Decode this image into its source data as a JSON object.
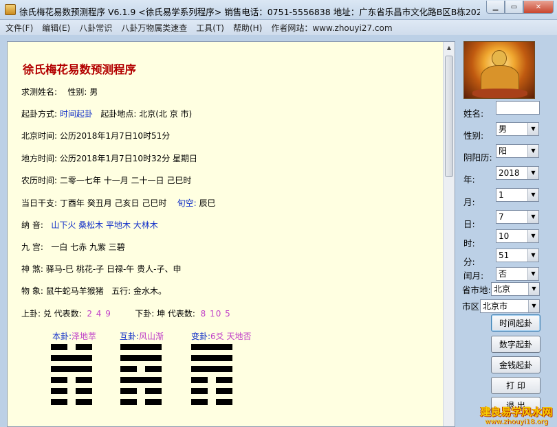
{
  "window": {
    "title": "徐氏梅花易数预测程序 V6.1.9 <徐氏易学系列程序>   销售电话：0751-5556838   地址：广东省乐昌市文化路B区B栋202...",
    "icons": [
      "app-icon",
      "minimize-icon",
      "maximize-icon",
      "close-icon"
    ]
  },
  "menu": [
    "文件(F)",
    "编辑(E)",
    "八卦常识",
    "八卦万物属类速查",
    "工具(T)",
    "帮助(H)",
    "作者网站：www.zhouyi27.com"
  ],
  "report": {
    "title": "徐氏梅花易数预测程序",
    "name_label": "求测姓名:",
    "gender_label": "性别:",
    "gender_value": "男",
    "method_label": "起卦方式:",
    "method_value": "时间起卦",
    "place_label": "起卦地点:",
    "place_value": "北京(北 京 市)",
    "bj_time_label": "北京时间:",
    "bj_time_value": "公历2018年1月7日10时51分",
    "local_time_label": "地方时间:",
    "local_time_value": "公历2018年1月7日10时32分  星期日",
    "lunar_label": "农历时间:",
    "lunar_value": "二零一七年  十一月  二十一日  己巳时",
    "ganzhi_label": "当日干支:",
    "ganzhi_value": "丁酉年  癸丑月  己亥日  己巳时",
    "xunkong_label": "旬空:",
    "xunkong_value": "辰巳",
    "nayin_label": "纳  音:",
    "nayin_value": "山下火  桑松木  平地木  大林木",
    "jiugong_label": "九  宫:",
    "jiugong_value": "一白    七赤    九紫    三碧",
    "shensha_label": "神  煞:",
    "shensha_value": "驿马-巳  桃花-子  日禄-午  贵人-子、申",
    "wuxiang_label": "物  象:",
    "wuxiang_value": "鼠牛蛇马羊猴猪",
    "wuxing_label": "五行:",
    "wuxing_value": "金水木。",
    "upper_label": "上卦: 兑 代表数:",
    "upper_nums": "2  4  9",
    "lower_label": "下卦: 坤 代表数:",
    "lower_nums": "8  10  5",
    "hexagrams": [
      {
        "label": "本卦:",
        "name": "泽地萃",
        "lines": [
          "yin",
          "yang",
          "yang",
          "yin",
          "yin",
          "yin"
        ]
      },
      {
        "label": "互卦:",
        "name": "风山渐",
        "lines": [
          "yang",
          "yang",
          "yin",
          "yang",
          "yin",
          "yin"
        ]
      },
      {
        "label": "变卦:",
        "name": "6爻  天地否",
        "lines": [
          "yang",
          "yang",
          "yang",
          "yin",
          "yin",
          "yin"
        ]
      }
    ]
  },
  "panel": {
    "name_label": "姓名:",
    "name_value": "",
    "gender_label": "性别:",
    "gender_value": "男",
    "calendar_label": "阴阳历:",
    "calendar_value": "阳",
    "year_label": "年:",
    "year_value": "2018",
    "month_label": "月:",
    "month_value": "1",
    "day_label": "日:",
    "day_value": "7",
    "hour_label": "时:",
    "hour_value": "10",
    "minute_label": "分:",
    "minute_value": "51",
    "leap_label": "闰月:",
    "leap_value": "否",
    "province_label": "省市地:",
    "province_value": "北京",
    "city_label": "市区",
    "city_value": "北京市",
    "buttons": [
      "时间起卦",
      "数字起卦",
      "金钱起卦",
      "打 印",
      "退 出"
    ]
  },
  "watermark": {
    "line1": "建良易学风水网",
    "line2": "www.zhouyi18.org"
  }
}
